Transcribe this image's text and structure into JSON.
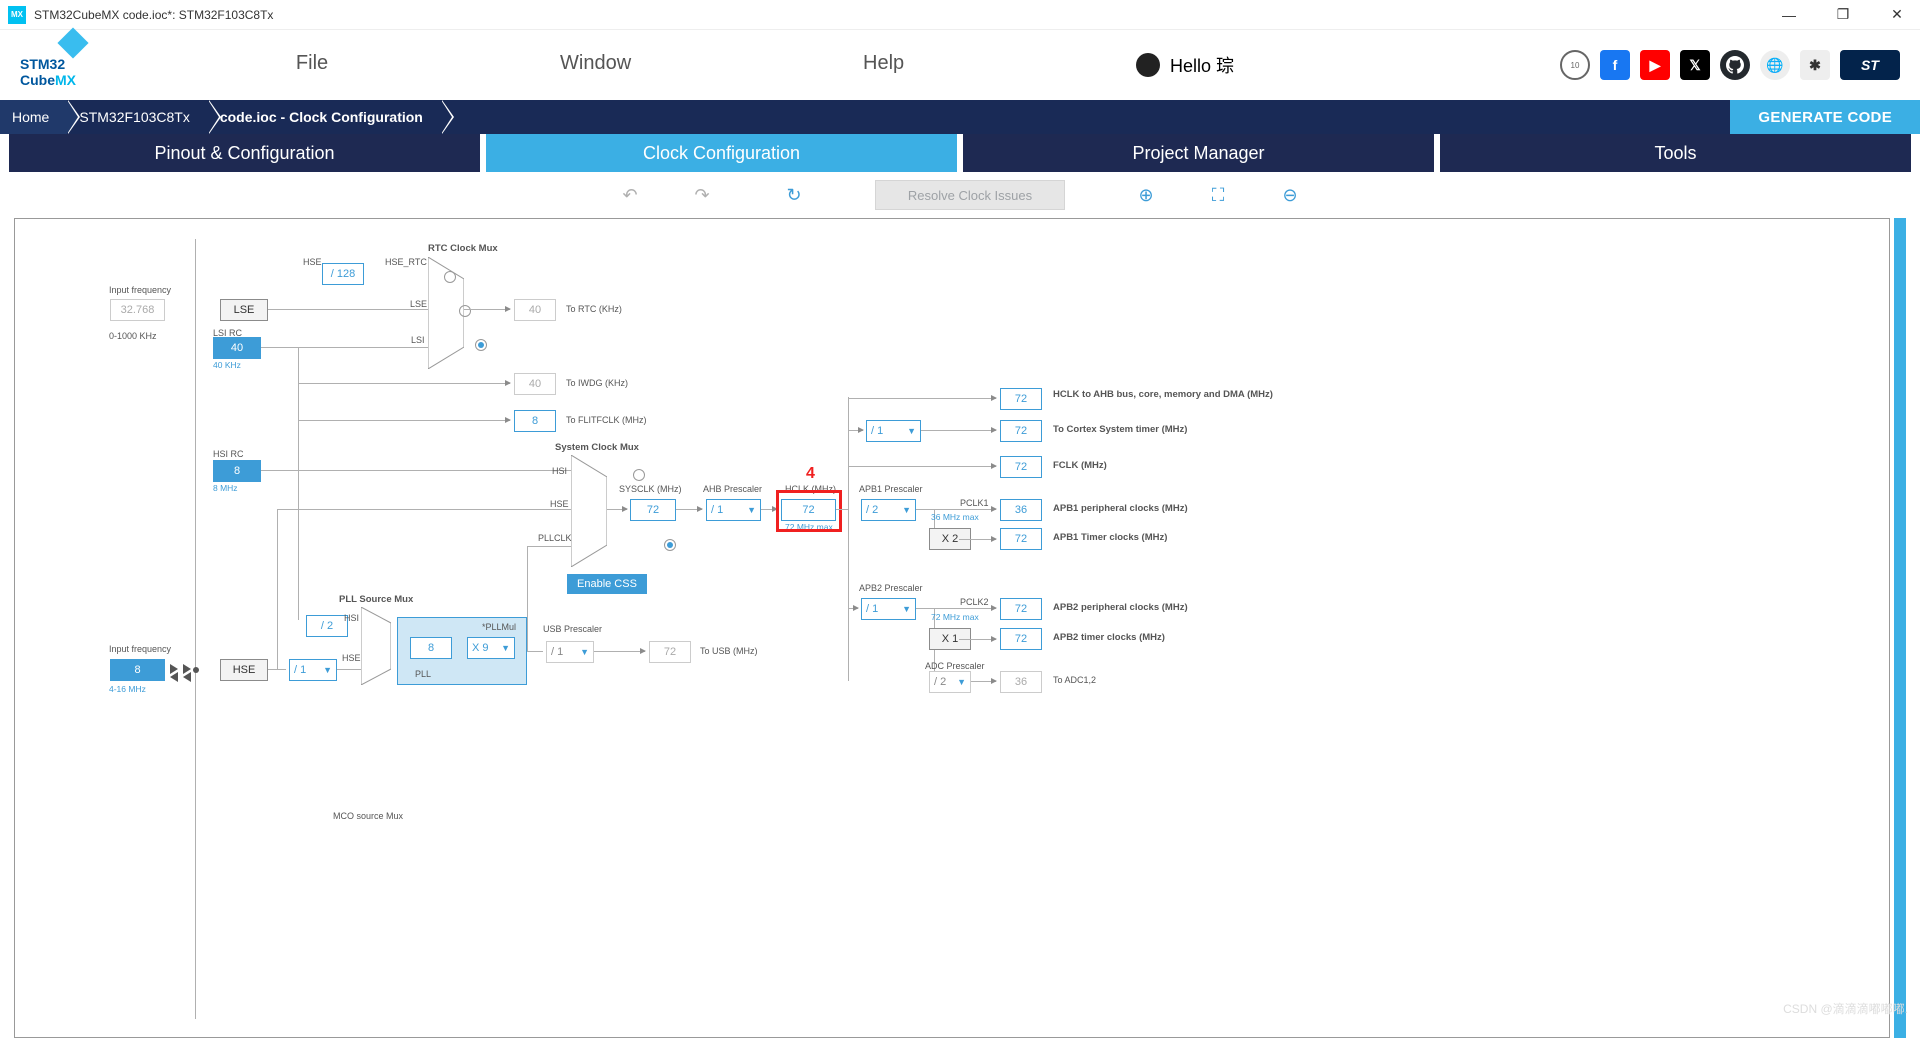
{
  "window": {
    "title": "STM32CubeMX code.ioc*: STM32F103C8Tx",
    "appIcon": "MX"
  },
  "logo": {
    "line1a": "STM32",
    "line1b": "",
    "line2": "CubeMX"
  },
  "menu": {
    "file": "File",
    "window": "Window",
    "help": "Help"
  },
  "user": {
    "greeting": "Hello 琮"
  },
  "social": {
    "fb": "f",
    "yt": "▶",
    "x": "𝕏",
    "gh": "",
    "wk": "W",
    "sf": "✱",
    "st": "ST",
    "award": "10"
  },
  "breadcrumb": {
    "home": "Home",
    "chip": "STM32F103C8Tx",
    "page": "code.ioc - Clock Configuration"
  },
  "generate": "GENERATE CODE",
  "tabs": {
    "pinout": "Pinout & Configuration",
    "clock": "Clock Configuration",
    "project": "Project Manager",
    "tools": "Tools"
  },
  "toolbar": {
    "resolve": "Resolve Clock Issues"
  },
  "annot": {
    "four": "4"
  },
  "labels": {
    "rtc_clock_mux": "RTC Clock Mux",
    "hse": "HSE",
    "hse_rtc": "HSE_RTC",
    "lse": "LSE",
    "lsi": "LSI",
    "inputfreq": "Input frequency",
    "range_khz": "0-1000 KHz",
    "range_mhz": "4-16 MHz",
    "lsi_rc": "LSI RC",
    "khz40": "40 KHz",
    "to_rtc": "To RTC (KHz)",
    "to_iwdg": "To IWDG (KHz)",
    "to_flitfclk": "To FLITFCLK (MHz)",
    "hsi_rc": "HSI RC",
    "mhz8": "8 MHz",
    "system_clock_mux": "System Clock Mux",
    "hsi": "HSI",
    "pllclk": "PLLCLK",
    "enable_css": "Enable CSS",
    "pll_source_mux": "PLL Source Mux",
    "pll": "PLL",
    "pllmul": "*PLLMul",
    "usb_prescaler": "USB Prescaler",
    "to_usb": "To USB (MHz)",
    "sysclk": "SYSCLK (MHz)",
    "ahb": "AHB Prescaler",
    "hclk": "HCLK (MHz)",
    "hmax": "72 MHz max",
    "apb1": "APB1 Prescaler",
    "pclk1": "PCLK1",
    "p1max": "36 MHz max",
    "apb2": "APB2 Prescaler",
    "pclk2": "PCLK2",
    "p2max": "72 MHz max",
    "adc": "ADC Prescaler",
    "hclk_ahb": "HCLK to AHB bus, core, memory and DMA (MHz)",
    "cortex": "To Cortex System timer (MHz)",
    "fclk": "FCLK (MHz)",
    "apb1p": "APB1 peripheral clocks (MHz)",
    "apb1t": "APB1 Timer clocks (MHz)",
    "apb2p": "APB2 peripheral clocks (MHz)",
    "apb2t": "APB2 timer clocks (MHz)",
    "to_adc": "To ADC1,2",
    "mco": "MCO source Mux"
  },
  "vals": {
    "lse_in": "32.768",
    "div128": "/ 128",
    "lse": "LSE",
    "lsi": "40",
    "rtc_out": "40",
    "iwdg": "40",
    "flitfclk": "8",
    "hsi": "8",
    "hse": "HSE",
    "hse_in": "8",
    "pll_prediv": "/ 2",
    "pll_src": "/ 1",
    "pll_m": "8",
    "pll_mul": "X 9",
    "usb_div": "/ 1",
    "usb": "72",
    "sysclk": "72",
    "ahb": "/ 1",
    "hclk": "72",
    "cortex_div": "/ 1",
    "apb1": "/ 2",
    "apb1_x": "X 2",
    "apb2": "/ 1",
    "apb2_x": "X 1",
    "adc": "/ 2",
    "hclk_ahb": "72",
    "cortex": "72",
    "fclk": "72",
    "pclk1": "36",
    "apb1t": "72",
    "pclk2": "72",
    "apb2t": "72",
    "adc_out": "36"
  },
  "watermark": "CSDN @滴滴滴嘟嘟嘟."
}
